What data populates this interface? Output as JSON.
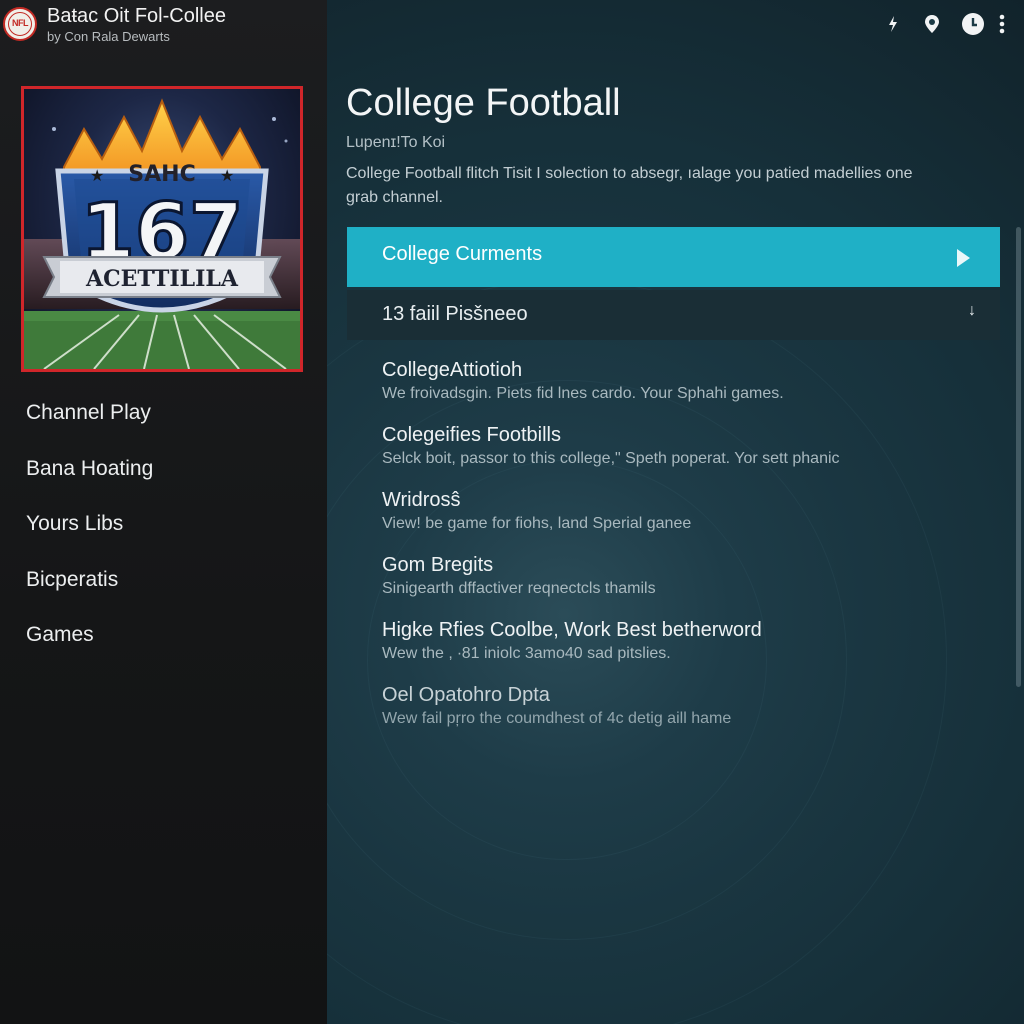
{
  "app": {
    "title": "Baŧac Oit Fol-Collee",
    "subtitle": "by Con Rala Dewarts",
    "logo_text": "NFL"
  },
  "cover": {
    "top_text": "SAHC",
    "number": "167",
    "banner": "ACETTILILA"
  },
  "sidebar": {
    "items": [
      {
        "label": "Channel Play"
      },
      {
        "label": "Bana Hoating"
      },
      {
        "label": "Yours Libs"
      },
      {
        "label": "Bicperatis"
      },
      {
        "label": "Games"
      }
    ]
  },
  "toolbar": {
    "icons": [
      "lightning-icon",
      "location-icon",
      "clock-icon",
      "more-icon"
    ]
  },
  "main": {
    "title": "College Football",
    "subtitle": "Lupenɪ!To Koi",
    "description": "College Football flitch Tisit I solection to absegr, ıalage you patied madellies one grab channel.",
    "primary_row": {
      "label": "College Curments"
    },
    "secondary_row": {
      "label": "13 faiil Pisšneeo",
      "arrow": "↓"
    },
    "items": [
      {
        "title": "CollegeAttiotioh",
        "desc": "We froivadsgin. Piets fid lnes cardo. Your Sphahi games."
      },
      {
        "title": "Colegeifies Footbills",
        "desc": "Selck boit, passor to this college,\" Speth poperat. Yor sett phanic"
      },
      {
        "title": "Wridrosŝ",
        "desc": "View! be game for fiohs, land Sperial ganee"
      },
      {
        "title": "Gom Bregits",
        "desc": "Sinigearth dffactiver reqnectcls thamils"
      },
      {
        "title": "Higke Rfies Coolbe, Work Best betherword",
        "desc": "Wew the ,  ∙81 iniolc 3amo40 sad pitslies."
      },
      {
        "title": "Oel Opatohro Dpta",
        "desc": "Wew fail pŗro the coumdhest of 4c detig aill hame"
      }
    ]
  },
  "colors": {
    "accent": "#1fb0c6",
    "cover_border": "#d0262a",
    "sidebar_bg": "#1c1d1f",
    "main_bg": "#1a3641"
  }
}
